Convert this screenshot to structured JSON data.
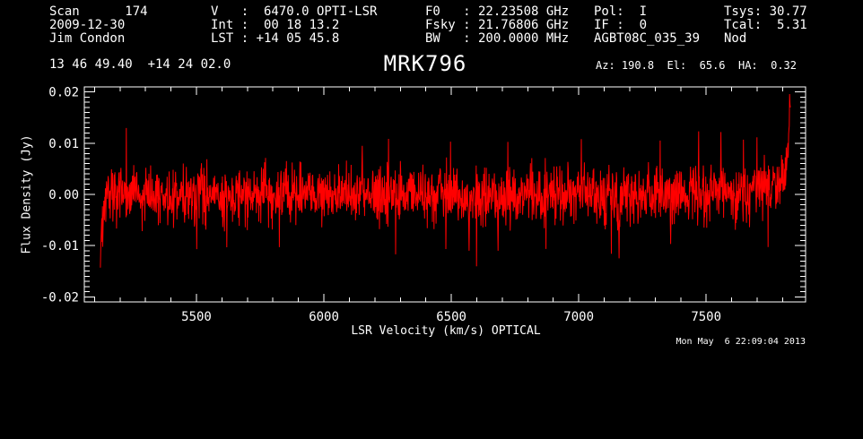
{
  "window": {
    "app": "GBTIDL Plotter",
    "background_color": "#000000",
    "text_color": "#ffffff"
  },
  "header": {
    "col1": {
      "lines": [
        "Scan      174",
        "2009-12-30",
        "Jim Condon"
      ]
    },
    "col2": {
      "lines": [
        "V   :  6470.0 OPTI-LSR",
        "Int :  00 18 13.2",
        "LST : +14 05 45.8"
      ]
    },
    "col3": {
      "lines": [
        "F0   : 22.23508 GHz",
        "Fsky : 21.76806 GHz",
        "BW   : 200.0000 MHz"
      ]
    },
    "col4": {
      "lines": [
        "Pol:  I",
        "IF :  0",
        "AGBT08C_035_39"
      ]
    },
    "col5": {
      "lines": [
        "Tsys: 30.77",
        "Tcal:  5.31",
        "Nod"
      ]
    }
  },
  "source_row": {
    "coordinates": "13 46 49.40  +14 24 02.0",
    "source_name": "MRK796",
    "pointing": "Az: 190.8  El:  65.6  HA:  0.32"
  },
  "footer": {
    "timestamp": "Mon May  6 22:09:04 2013"
  },
  "chart_data": {
    "type": "line",
    "title": "MRK796",
    "xlabel": "LSR Velocity (km/s) OPTICAL",
    "ylabel": "Flux Density (Jy)",
    "xlim": [
      5060,
      7890
    ],
    "ylim": [
      -0.021,
      0.021
    ],
    "x_major_ticks": [
      5500,
      6000,
      6500,
      7000,
      7500
    ],
    "x_tick_labels": [
      "5500",
      "6000",
      "6500",
      "7000",
      "7500"
    ],
    "x_minor_tick_step": 100,
    "y_major_ticks": [
      -0.02,
      -0.01,
      0,
      0.01,
      0.02
    ],
    "y_tick_labels": [
      "-0.02",
      "-0.01",
      "0.00",
      "0.01",
      "0.02"
    ],
    "y_minor_tick_step": 0.001,
    "grid": false,
    "legend": "none",
    "colors": {
      "frame": "#ffffff",
      "trace": "#ff0000",
      "background": "#000000"
    },
    "series": [
      {
        "name": "flux-density-spectrum",
        "color": "#ff0000",
        "style": "noisy-line",
        "x_start": 5123,
        "x_end": 7830,
        "n_points": 2048,
        "baseline_jy": 0.0,
        "noise_sigma_jy": 0.0028,
        "seed": 20130506,
        "left_edge": {
          "x": 5123,
          "min_jy": -0.0135,
          "decay_channels": 5
        },
        "right_edge": {
          "x": 7830,
          "max_jy": 0.0174,
          "decay_channels": 5.5
        },
        "notable_excursions": [
          {
            "x": 6150,
            "jy": 0.0095
          },
          {
            "x": 6570,
            "jy": -0.011
          },
          {
            "x": 6683,
            "jy": -0.011
          },
          {
            "x": 7158,
            "jy": -0.0125
          },
          {
            "x": 7360,
            "jy": -0.0097
          }
        ]
      }
    ]
  }
}
